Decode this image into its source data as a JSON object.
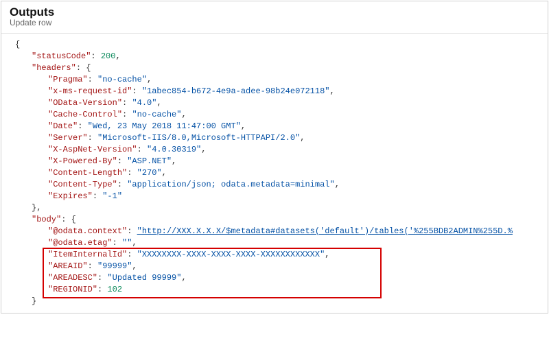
{
  "header": {
    "title": "Outputs",
    "subtitle": "Update row"
  },
  "json": {
    "open": "{",
    "statusCode_key": "\"statusCode\"",
    "statusCode_val": "200",
    "headers_key": "\"headers\"",
    "headers_open": "{",
    "pragma_key": "\"Pragma\"",
    "pragma_val": "\"no-cache\"",
    "xms_key": "\"x-ms-request-id\"",
    "xms_val": "\"1abec854-b672-4e9a-adee-98b24e072118\"",
    "odv_key": "\"OData-Version\"",
    "odv_val": "\"4.0\"",
    "cache_key": "\"Cache-Control\"",
    "cache_val": "\"no-cache\"",
    "date_key": "\"Date\"",
    "date_val": "\"Wed, 23 May 2018 11:47:00 GMT\"",
    "server_key": "\"Server\"",
    "server_val": "\"Microsoft-IIS/8.0,Microsoft-HTTPAPI/2.0\"",
    "xan_key": "\"X-AspNet-Version\"",
    "xan_val": "\"4.0.30319\"",
    "xpb_key": "\"X-Powered-By\"",
    "xpb_val": "\"ASP.NET\"",
    "clen_key": "\"Content-Length\"",
    "clen_val": "\"270\"",
    "ctype_key": "\"Content-Type\"",
    "ctype_val": "\"application/json; odata.metadata=minimal\"",
    "exp_key": "\"Expires\"",
    "exp_val": "\"-1\"",
    "headers_close": "}",
    "body_key": "\"body\"",
    "body_open": "{",
    "octx_key": "\"@odata.context\"",
    "octx_val": "\"http://XXX.X.X.X/$metadata#datasets('default')/tables('%255BDB2ADMIN%255D.%",
    "oetag_key": "\"@odata.etag\"",
    "oetag_val": "\"\"",
    "iid_key": "\"ItemInternalId\"",
    "iid_val": "\"XXXXXXXX-XXXX-XXXX-XXXX-XXXXXXXXXXXX\"",
    "aid_key": "\"AREAID\"",
    "aid_val": "\"99999\"",
    "adesc_key": "\"AREADESC\"",
    "adesc_val": "\"Updated 99999\"",
    "rid_key": "\"REGIONID\"",
    "rid_val": "102",
    "body_close": "}"
  },
  "colon": ": ",
  "comma": ","
}
